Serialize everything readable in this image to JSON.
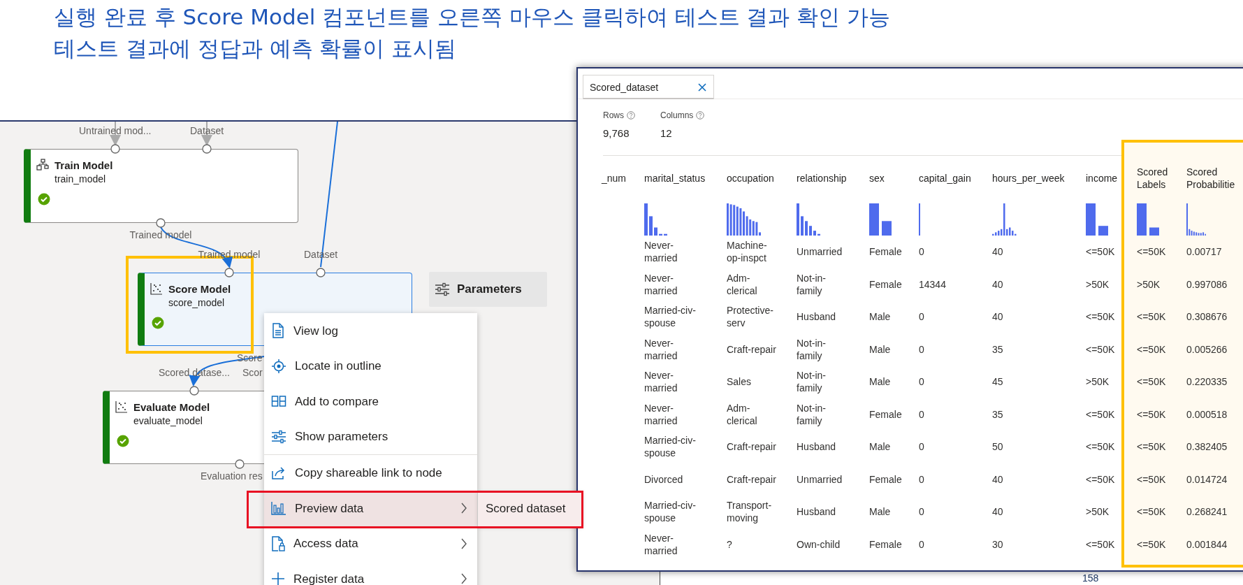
{
  "heading": [
    "실행 완료 후 Score Model 컴포넌트를 오른쪽 마우스 클릭하여 테스트 결과 확인 가능",
    "테스트 결과에 정답과 예측 확률이 표시됨"
  ],
  "pipeline": {
    "nodes": [
      {
        "title": "Train Model",
        "name": "train_model",
        "completed": true,
        "selected": false,
        "inputs": [
          "Untrained mod...",
          "Dataset"
        ],
        "outputs": [
          "Trained model"
        ]
      },
      {
        "title": "Score Model",
        "name": "score_model",
        "completed": true,
        "selected": true,
        "annotated": true,
        "inputs": [
          "Trained model",
          "Dataset"
        ],
        "outputs": [
          "Score"
        ]
      },
      {
        "title": "Evaluate Model",
        "name": "evaluate_model",
        "completed": true,
        "selected": false,
        "inputs": [
          "Scored datase...",
          "Scor"
        ],
        "outputs": [
          "Evaluation res"
        ]
      }
    ],
    "parameters_button": {
      "label": "Parameters"
    }
  },
  "context_menu": {
    "items": [
      {
        "label": "View log",
        "highlighted": false,
        "submenu": false
      },
      {
        "label": "Locate in outline",
        "highlighted": false,
        "submenu": false
      },
      {
        "label": "Add to compare",
        "highlighted": false,
        "submenu": false
      },
      {
        "label": "Show parameters",
        "highlighted": false,
        "submenu": false
      },
      {
        "label": "Copy shareable link to node",
        "highlighted": false,
        "separator_before": true,
        "submenu": false
      },
      {
        "label": "Preview data",
        "highlighted": true,
        "submenu": true,
        "annotated": true,
        "submenu_items": [
          "Scored dataset"
        ]
      },
      {
        "label": "Access data",
        "highlighted": false,
        "submenu": true
      },
      {
        "label": "Register data",
        "highlighted": false,
        "submenu": true
      }
    ]
  },
  "data_window": {
    "tab": {
      "label": "Scored_dataset",
      "selected": true
    },
    "stats": [
      {
        "label": "Rows",
        "value": "9,768"
      },
      {
        "label": "Columns",
        "value": "12"
      }
    ],
    "columns": [
      {
        "label": "_num",
        "annotated": false
      },
      {
        "label": "marital_status",
        "annotated": false
      },
      {
        "label": "occupation",
        "annotated": false
      },
      {
        "label": "relationship",
        "annotated": false
      },
      {
        "label": "sex",
        "annotated": false
      },
      {
        "label": "capital_gain",
        "annotated": false
      },
      {
        "label": "hours_per_week",
        "annotated": false
      },
      {
        "label": "income",
        "annotated": false
      },
      {
        "label": "Scored Labels",
        "annotated": true
      },
      {
        "label": "Scored Probabilitie",
        "annotated": true
      }
    ],
    "rows": [
      [
        "",
        "Never-married",
        "Machine-op-inspct",
        "Unmarried",
        "Female",
        "0",
        "40",
        "<=50K",
        "<=50K",
        "0.00717"
      ],
      [
        "",
        "Never-married",
        "Adm-clerical",
        "Not-in-family",
        "Female",
        "14344",
        "40",
        ">50K",
        ">50K",
        "0.997086"
      ],
      [
        "",
        "Married-civ-spouse",
        "Protective-serv",
        "Husband",
        "Male",
        "0",
        "40",
        "<=50K",
        "<=50K",
        "0.308676"
      ],
      [
        "",
        "Never-married",
        "Craft-repair",
        "Not-in-family",
        "Male",
        "0",
        "35",
        "<=50K",
        "<=50K",
        "0.005266"
      ],
      [
        "",
        "Never-married",
        "Sales",
        "Not-in-family",
        "Male",
        "0",
        "45",
        ">50K",
        "<=50K",
        "0.220335"
      ],
      [
        "",
        "Never-married",
        "Adm-clerical",
        "Not-in-family",
        "Female",
        "0",
        "35",
        "<=50K",
        "<=50K",
        "0.000518"
      ],
      [
        "",
        "Married-civ-spouse",
        "Craft-repair",
        "Husband",
        "Male",
        "0",
        "50",
        "<=50K",
        "<=50K",
        "0.382405"
      ],
      [
        "",
        "Divorced",
        "Craft-repair",
        "Unmarried",
        "Female",
        "0",
        "40",
        "<=50K",
        "<=50K",
        "0.014724"
      ],
      [
        "",
        "Married-civ-spouse",
        "Transport-moving",
        "Husband",
        "Male",
        "0",
        "40",
        ">50K",
        "<=50K",
        "0.268241"
      ],
      [
        "",
        "Never-married",
        "?",
        "Own-child",
        "Female",
        "0",
        "30",
        "<=50K",
        "<=50K",
        "0.001844"
      ]
    ]
  },
  "page_number": "158"
}
